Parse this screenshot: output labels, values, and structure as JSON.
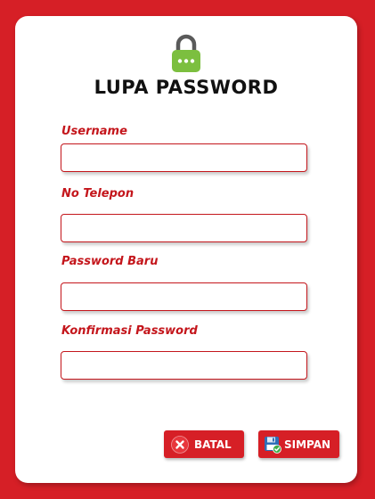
{
  "page": {
    "title": "LUPA PASSWORD"
  },
  "form": {
    "fields": [
      {
        "label": "Username",
        "value": "",
        "placeholder": ""
      },
      {
        "label": "No Telepon",
        "value": "",
        "placeholder": ""
      },
      {
        "label": "Password Baru",
        "value": "",
        "placeholder": ""
      },
      {
        "label": "Konfirmasi Password",
        "value": "",
        "placeholder": ""
      }
    ]
  },
  "buttons": {
    "cancel_label": "BATAL",
    "save_label": "SIMPAN"
  },
  "icons": {
    "lock": "lock-icon",
    "cancel": "close-circle-icon",
    "save": "floppy-disk-icon"
  },
  "colors": {
    "background": "#d61f26",
    "accent": "#c4161c",
    "lock_green": "#7cbf3f",
    "card": "#ffffff"
  }
}
